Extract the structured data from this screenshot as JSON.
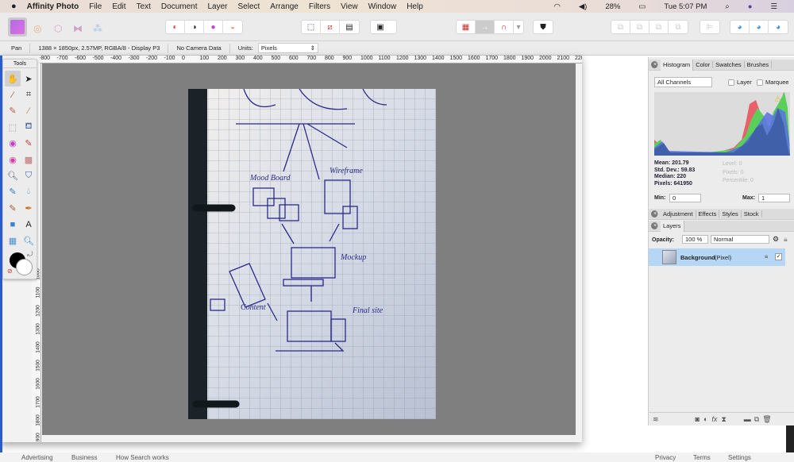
{
  "menubar": {
    "app": "Affinity Photo",
    "items": [
      "File",
      "Edit",
      "Text",
      "Document",
      "Layer",
      "Select",
      "Arrange",
      "Filters",
      "View",
      "Window",
      "Help"
    ],
    "battery": "28%",
    "clock": "Tue 5:07 PM"
  },
  "context": {
    "tool": "Pan",
    "doc_info": "1388 × 1850px, 2.57MP, RGBA/8 - Display P3",
    "camera": "No Camera Data",
    "units_label": "Units:",
    "units_value": "Pixels"
  },
  "rulers": {
    "h": [
      "-800",
      "-700",
      "-600",
      "-500",
      "-400",
      "-300",
      "-200",
      "-100",
      "0",
      "100",
      "200",
      "300",
      "400",
      "500",
      "600",
      "700",
      "800",
      "900",
      "1000",
      "1100",
      "1200",
      "1300",
      "1400",
      "1500",
      "1600",
      "1700",
      "1800",
      "1900",
      "2000",
      "2100",
      "2200"
    ],
    "v": [
      "1000",
      "1100",
      "1200",
      "1300",
      "1400",
      "1500",
      "1600",
      "1700",
      "1800",
      "1900"
    ]
  },
  "tools": {
    "title": "Tools"
  },
  "sketch": {
    "labels": [
      "Mood Board",
      "Wireframe",
      "Mockup",
      "Content",
      "Final site"
    ]
  },
  "histogram": {
    "tabs": [
      "Histogram",
      "Color",
      "Swatches",
      "Brushes"
    ],
    "channel": "All Channels",
    "layer_label": "Layer",
    "marquee_label": "Marquee",
    "mean": "Mean: 201.79",
    "std": "Std. Dev.: 59.83",
    "median": "Median: 220",
    "pixels": "Pixels: 641950",
    "level": "Level: 0",
    "pix2": "Pixels: 0",
    "percentile": "Percentile: 0",
    "min_label": "Min:",
    "min": "0",
    "max_label": "Max:",
    "max": "1",
    "colors": {
      "red": "#e8606a",
      "green": "#5ad05a",
      "blue": "#5a6ee8"
    }
  },
  "adjust_tabs": [
    "Adjustment",
    "Effects",
    "Styles",
    "Stock"
  ],
  "layers": {
    "tab": "Layers",
    "opacity_label": "Opacity:",
    "opacity": "100 %",
    "blend": "Normal",
    "layer_name": "Background",
    "layer_type": "(Pixel)"
  },
  "footer": {
    "left": [
      "Advertising",
      "Business",
      "How Search works"
    ],
    "right": [
      "Privacy",
      "Terms",
      "Settings"
    ]
  }
}
